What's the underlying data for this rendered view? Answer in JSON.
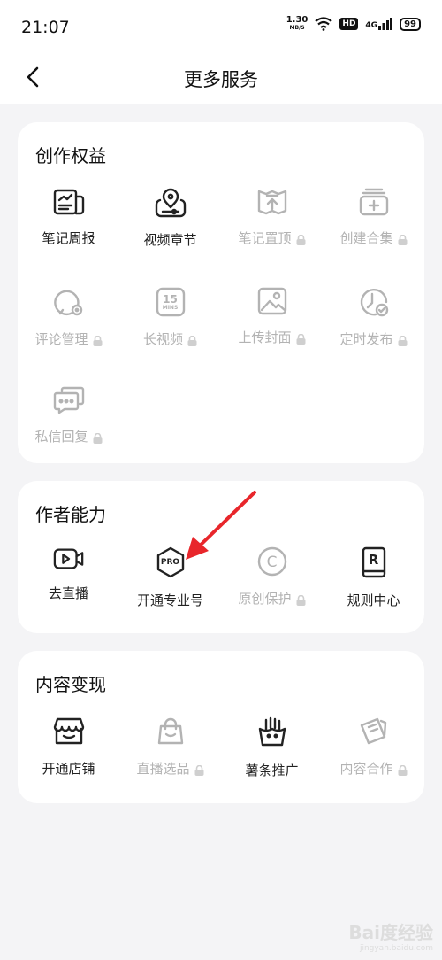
{
  "status": {
    "time": "21:07",
    "speed": "1.30",
    "speed_unit": "MB/S",
    "hd": "HD",
    "net": "4G",
    "battery": "99"
  },
  "nav": {
    "title": "更多服务"
  },
  "sections": [
    {
      "title": "创作权益",
      "items": [
        {
          "label": "笔记周报",
          "icon": "weekly-report-icon",
          "locked": false
        },
        {
          "label": "视频章节",
          "icon": "video-chapter-icon",
          "locked": false
        },
        {
          "label": "笔记置顶",
          "icon": "pin-top-icon",
          "locked": true
        },
        {
          "label": "创建合集",
          "icon": "collection-icon",
          "locked": true
        },
        {
          "label": "评论管理",
          "icon": "comment-manage-icon",
          "locked": true
        },
        {
          "label": "长视频",
          "icon": "long-video-icon",
          "locked": true
        },
        {
          "label": "上传封面",
          "icon": "upload-cover-icon",
          "locked": true
        },
        {
          "label": "定时发布",
          "icon": "scheduled-publish-icon",
          "locked": true
        },
        {
          "label": "私信回复",
          "icon": "message-reply-icon",
          "locked": true
        }
      ]
    },
    {
      "title": "作者能力",
      "items": [
        {
          "label": "去直播",
          "icon": "live-camera-icon",
          "locked": false
        },
        {
          "label": "开通专业号",
          "icon": "pro-badge-icon",
          "locked": false
        },
        {
          "label": "原创保护",
          "icon": "copyright-icon",
          "locked": true
        },
        {
          "label": "规则中心",
          "icon": "rules-book-icon",
          "locked": false
        }
      ]
    },
    {
      "title": "内容变现",
      "items": [
        {
          "label": "开通店铺",
          "icon": "shop-icon",
          "locked": false
        },
        {
          "label": "直播选品",
          "icon": "shopping-bag-icon",
          "locked": true
        },
        {
          "label": "薯条推广",
          "icon": "fries-icon",
          "locked": false
        },
        {
          "label": "内容合作",
          "icon": "cooperation-icon",
          "locked": true
        }
      ]
    }
  ],
  "icon_text": {
    "mins_number": "15",
    "mins_unit": "MINS",
    "pro": "PRO",
    "copyright": "C",
    "rules": "R"
  },
  "watermark": {
    "brand": "Bai度经验",
    "url": "jingyan.baidu.com"
  },
  "colors": {
    "active": "#222222",
    "disabled": "#b3b3b3",
    "arrow": "#e8262b",
    "background": "#f4f4f6"
  }
}
